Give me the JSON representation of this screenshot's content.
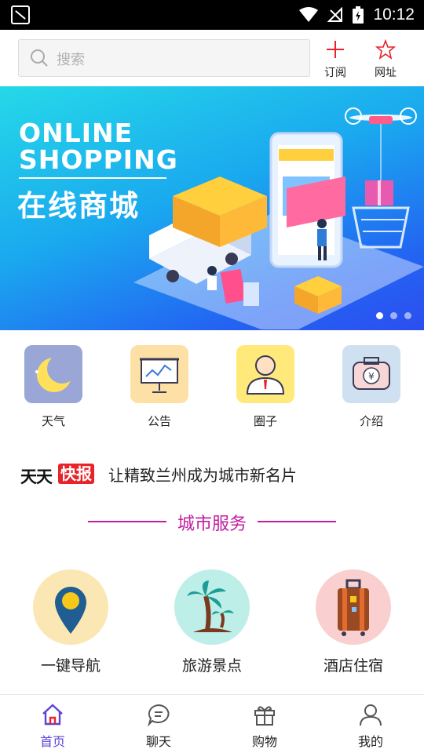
{
  "status_bar": {
    "time": "10:12"
  },
  "search": {
    "placeholder": "搜索"
  },
  "header_actions": [
    {
      "label": "订阅",
      "icon": "plus-icon"
    },
    {
      "label": "网址",
      "icon": "star-icon"
    }
  ],
  "banner": {
    "title_en_line1": "ONLINE",
    "title_en_line2": "SHOPPING",
    "title_cn": "在线商城",
    "slide_count": 3,
    "active_slide": 1
  },
  "quick_tiles": [
    {
      "label": "天气",
      "icon": "moon-icon",
      "bg": "#9aa6d6"
    },
    {
      "label": "公告",
      "icon": "presentation-board-icon",
      "bg": "#fde0a6"
    },
    {
      "label": "圈子",
      "icon": "person-icon",
      "bg": "#ffe97a"
    },
    {
      "label": "介绍",
      "icon": "money-case-icon",
      "bg": "#cfe0f0"
    }
  ],
  "news": {
    "badge_prefix": "天天",
    "badge_highlight": "快报",
    "headline": "让精致兰州成为城市新名片"
  },
  "section_title": "城市服务",
  "services": [
    {
      "label": "一键导航",
      "icon": "map-pin-icon",
      "bg": "#fbe7b3"
    },
    {
      "label": "旅游景点",
      "icon": "palm-tree-icon",
      "bg": "#bdeee8"
    },
    {
      "label": "酒店住宿",
      "icon": "luggage-icon",
      "bg": "#f9cfcf"
    }
  ],
  "bottom_nav": [
    {
      "label": "首页",
      "icon": "home-icon",
      "active": true
    },
    {
      "label": "聊天",
      "icon": "chat-icon",
      "active": false
    },
    {
      "label": "购物",
      "icon": "gift-icon",
      "active": false
    },
    {
      "label": "我的",
      "icon": "user-icon",
      "active": false
    }
  ],
  "colors": {
    "accent": "#c31d9e",
    "nav_active": "#5b45d8",
    "news_badge": "#e8232a",
    "header_icon": "#e8232a"
  }
}
